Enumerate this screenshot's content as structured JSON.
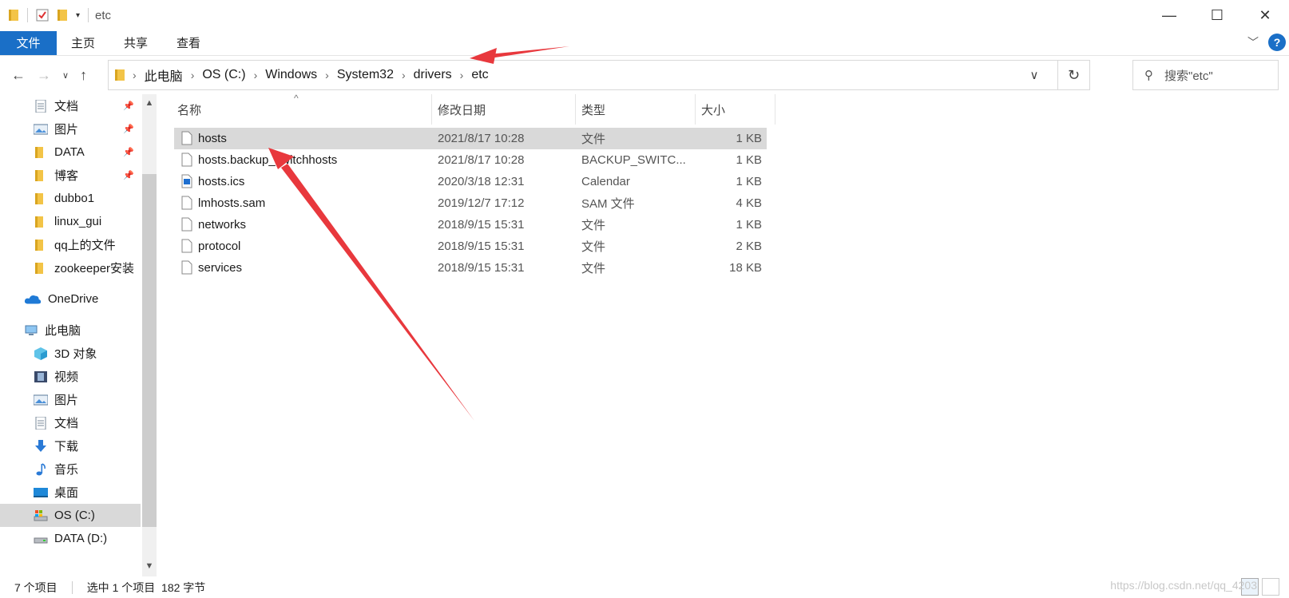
{
  "window": {
    "title": "etc",
    "controls": [
      "minimize-icon",
      "maximize-icon",
      "close-icon"
    ]
  },
  "ribbon": {
    "tabs": [
      {
        "label": "文件",
        "active": true
      },
      {
        "label": "主页"
      },
      {
        "label": "共享"
      },
      {
        "label": "查看"
      }
    ],
    "help_label": "?"
  },
  "address": {
    "crumbs": [
      "此电脑",
      "OS (C:)",
      "Windows",
      "System32",
      "drivers",
      "etc"
    ],
    "search_placeholder": "搜索\"etc\""
  },
  "sidebar": {
    "items": [
      {
        "label": "文档",
        "icon": "documents-icon",
        "pinned": true
      },
      {
        "label": "图片",
        "icon": "pictures-icon",
        "pinned": true
      },
      {
        "label": "DATA",
        "icon": "folder-icon",
        "pinned": true
      },
      {
        "label": "博客",
        "icon": "folder-icon",
        "pinned": true
      },
      {
        "label": "dubbo1",
        "icon": "folder-icon"
      },
      {
        "label": "linux_gui",
        "icon": "folder-icon"
      },
      {
        "label": "qq上的文件",
        "icon": "folder-icon"
      },
      {
        "label": "zookeeper安装",
        "icon": "folder-icon"
      },
      {
        "label": "OneDrive",
        "icon": "onedrive-icon"
      },
      {
        "label": "此电脑",
        "icon": "this-pc-icon"
      },
      {
        "label": "3D 对象",
        "icon": "3d-objects-icon"
      },
      {
        "label": "视频",
        "icon": "videos-icon"
      },
      {
        "label": "图片",
        "icon": "pictures-icon"
      },
      {
        "label": "文档",
        "icon": "documents-icon"
      },
      {
        "label": "下载",
        "icon": "downloads-icon"
      },
      {
        "label": "音乐",
        "icon": "music-icon"
      },
      {
        "label": "桌面",
        "icon": "desktop-icon"
      },
      {
        "label": "OS (C:)",
        "icon": "drive-c-icon",
        "selected": true
      },
      {
        "label": "DATA (D:)",
        "icon": "drive-d-icon"
      }
    ]
  },
  "filelist": {
    "columns": {
      "name": "名称",
      "date": "修改日期",
      "type": "类型",
      "size": "大小"
    },
    "rows": [
      {
        "name": "hosts",
        "date": "2021/8/17 10:28",
        "type": "文件",
        "size": "1 KB",
        "selected": true
      },
      {
        "name": "hosts.backup_switchhosts",
        "date": "2021/8/17 10:28",
        "type": "BACKUP_SWITC...",
        "size": "1 KB"
      },
      {
        "name": "hosts.ics",
        "date": "2020/3/18 12:31",
        "type": "Calendar",
        "size": "1 KB"
      },
      {
        "name": "lmhosts.sam",
        "date": "2019/12/7 17:12",
        "type": "SAM 文件",
        "size": "4 KB"
      },
      {
        "name": "networks",
        "date": "2018/9/15 15:31",
        "type": "文件",
        "size": "1 KB"
      },
      {
        "name": "protocol",
        "date": "2018/9/15 15:31",
        "type": "文件",
        "size": "2 KB"
      },
      {
        "name": "services",
        "date": "2018/9/15 15:31",
        "type": "文件",
        "size": "18 KB"
      }
    ]
  },
  "status": {
    "item_count": "7 个项目",
    "selection": "选中 1 个项目  182 字节"
  },
  "watermark": "https://blog.csdn.net/qq_4203",
  "colors": {
    "accent": "#1a6fc7",
    "selection": "#d9d9d9",
    "folder": "#f3c447",
    "annotation": "#e8383d"
  }
}
